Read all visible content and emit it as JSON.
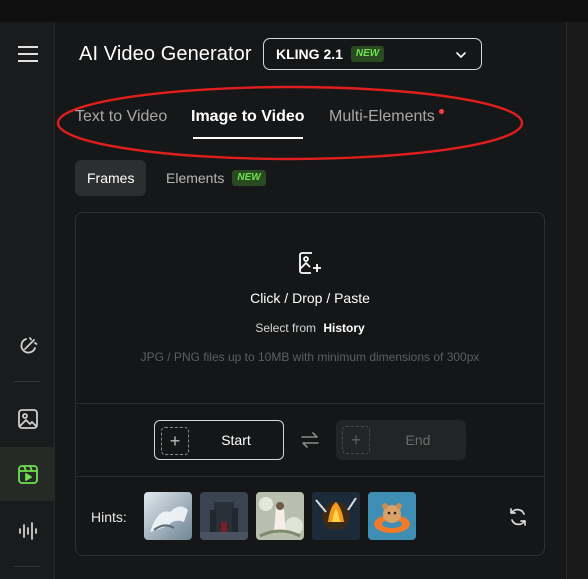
{
  "header": {
    "title": "AI Video Generator",
    "model": {
      "name": "KLING 2.1",
      "badge": "NEW"
    }
  },
  "sidebar": {
    "icons": [
      "magic-pen-icon",
      "image-icon",
      "video-icon",
      "audio-wave-icon"
    ],
    "active": "video-icon"
  },
  "tabs": [
    "Text to Video",
    "Image to Video",
    "Multi-Elements"
  ],
  "active_tab": "Image to Video",
  "subtabs": {
    "frames": "Frames",
    "elements": "Elements",
    "elements_badge": "NEW"
  },
  "upload": {
    "main": "Click / Drop / Paste",
    "select_prefix": "Select from",
    "select_link": "History",
    "hint": "JPG / PNG files up to 10MB with minimum dimensions of 300px"
  },
  "frames": {
    "plus": "+",
    "start": "Start",
    "end": "End"
  },
  "hints": {
    "label": "Hints:"
  },
  "colors": {
    "accent_green": "#6fe04f",
    "annotation_red": "#e01e1e",
    "notification_dot": "#ff3b3b"
  }
}
